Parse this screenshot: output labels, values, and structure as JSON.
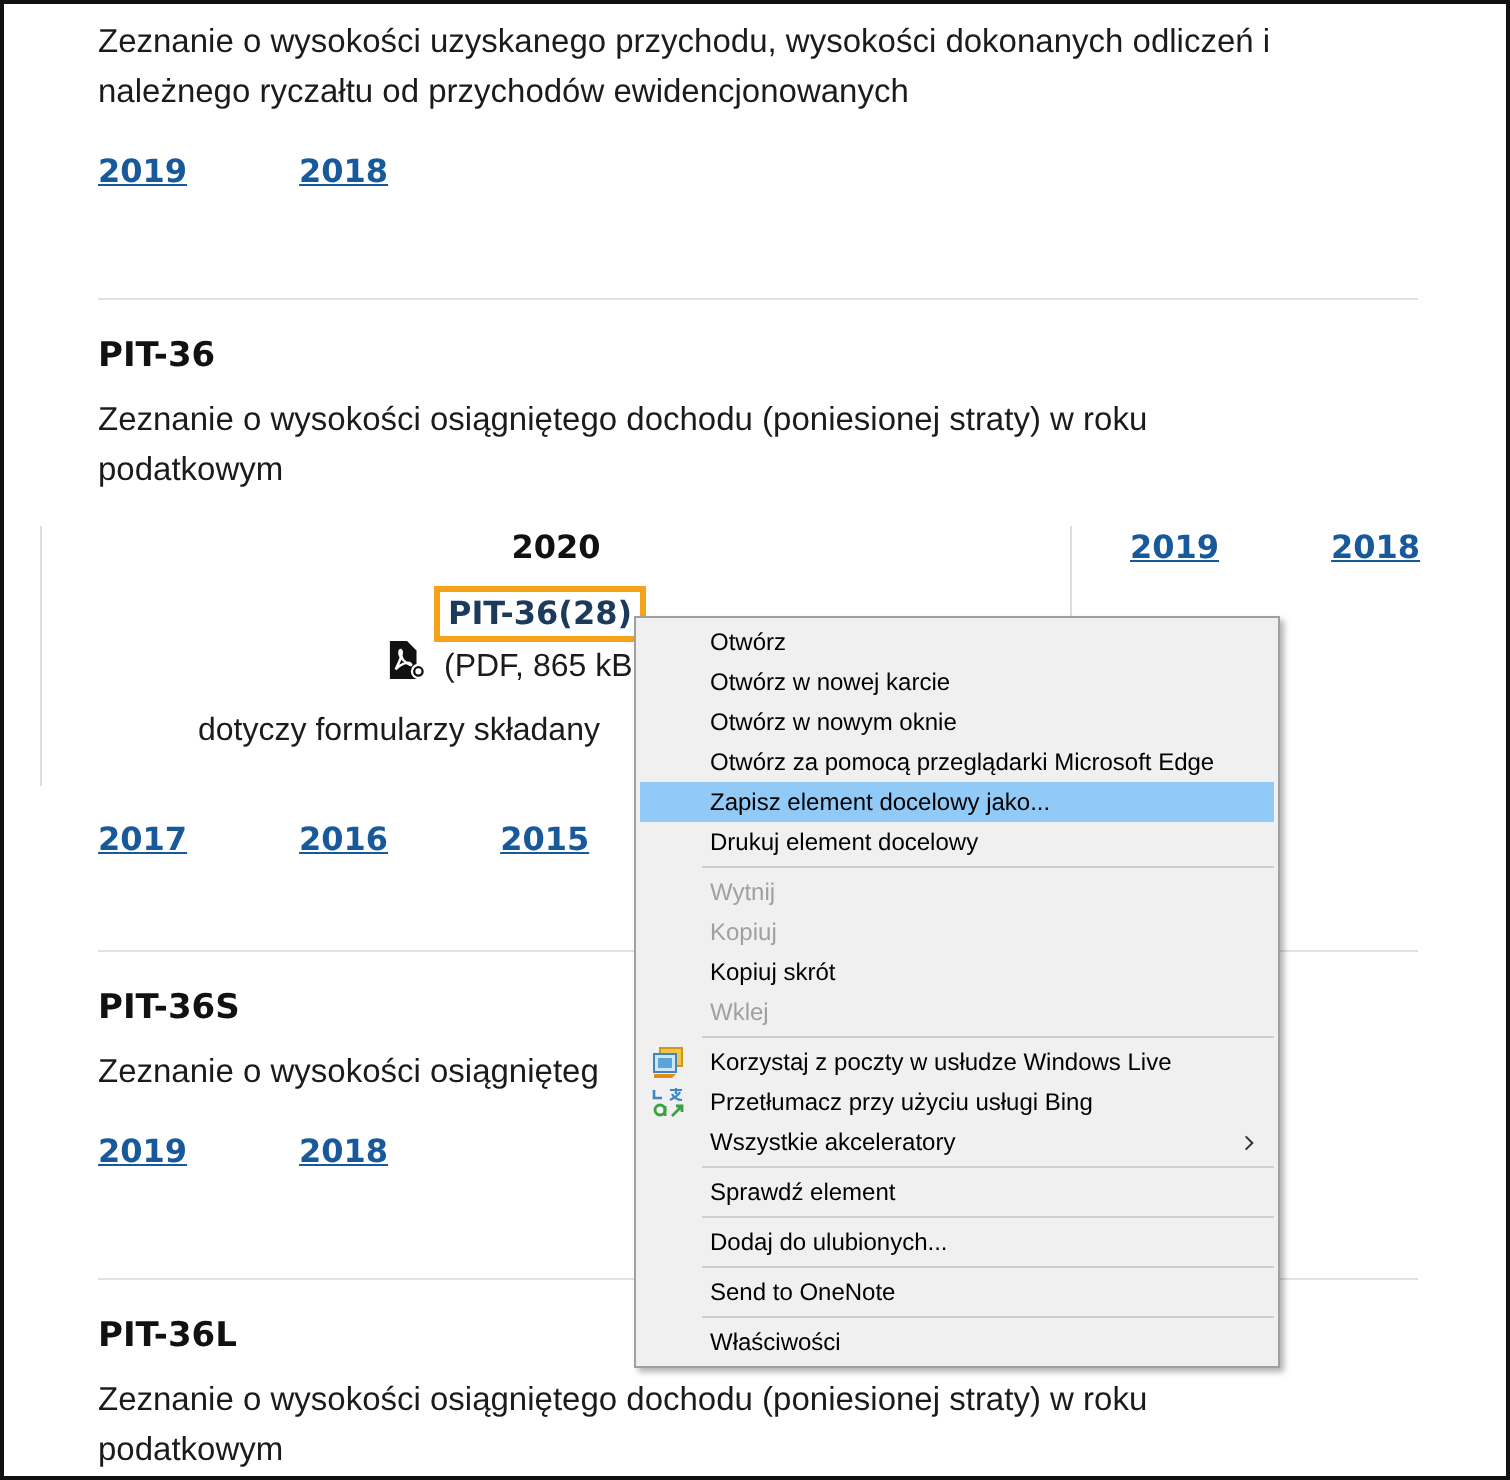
{
  "sections": [
    {
      "description": "Zeznanie o wysokości uzyskanego przychodu, wysokości dokonanych odliczeń i należnego ryczałtu od przychodów ewidencjonowanych",
      "years": [
        "2019",
        "2018"
      ]
    },
    {
      "heading": "PIT-36",
      "description": "Zeznanie o wysokości osiągniętego dochodu (poniesionej straty) w roku podatkowym",
      "featured": {
        "year": "2020",
        "file": {
          "title": "PIT-36(28)",
          "focused": true,
          "size": "(PDF, 865 kB",
          "note": "dotyczy formularzy składany"
        },
        "side_years": [
          "2019",
          "2018"
        ]
      },
      "years": [
        "2017",
        "2016",
        "2015"
      ]
    },
    {
      "heading": "PIT-36S",
      "description": "Zeznanie o wysokości osiągnięteg",
      "years": [
        "2019",
        "2018"
      ]
    },
    {
      "heading": "PIT-36L",
      "description": "Zeznanie o wysokości osiągniętego dochodu (poniesionej straty) w roku podatkowym"
    }
  ],
  "context_menu": {
    "items": [
      {
        "kind": "item",
        "label": "Otwórz",
        "disabled": false,
        "selected": false
      },
      {
        "kind": "item",
        "label": "Otwórz w nowej karcie",
        "disabled": false,
        "selected": false
      },
      {
        "kind": "item",
        "label": "Otwórz w nowym oknie",
        "disabled": false,
        "selected": false
      },
      {
        "kind": "item",
        "label": "Otwórz za pomocą przeglądarki Microsoft Edge",
        "disabled": false,
        "selected": false
      },
      {
        "kind": "item",
        "label": "Zapisz element docelowy jako...",
        "disabled": false,
        "selected": true
      },
      {
        "kind": "item",
        "label": "Drukuj element docelowy",
        "disabled": false,
        "selected": false
      },
      {
        "kind": "separator"
      },
      {
        "kind": "item",
        "label": "Wytnij",
        "disabled": true,
        "selected": false
      },
      {
        "kind": "item",
        "label": "Kopiuj",
        "disabled": true,
        "selected": false
      },
      {
        "kind": "item",
        "label": "Kopiuj skrót",
        "disabled": false,
        "selected": false
      },
      {
        "kind": "item",
        "label": "Wklej",
        "disabled": true,
        "selected": false
      },
      {
        "kind": "separator"
      },
      {
        "kind": "icon-item",
        "label": "Korzystaj z poczty w usłudze Windows Live",
        "disabled": false,
        "selected": false
      },
      {
        "kind": "icon-item",
        "label": "Przetłumacz przy użyciu usługi Bing",
        "disabled": false,
        "selected": false
      },
      {
        "kind": "item",
        "label": "Wszystkie akceleratory",
        "disabled": false,
        "selected": false,
        "submenu": true
      },
      {
        "kind": "separator"
      },
      {
        "kind": "item",
        "label": "Sprawdź element",
        "disabled": false,
        "selected": false
      },
      {
        "kind": "separator"
      },
      {
        "kind": "item",
        "label": "Dodaj do ulubionych...",
        "disabled": false,
        "selected": false
      },
      {
        "kind": "separator"
      },
      {
        "kind": "item",
        "label": "Send to OneNote",
        "disabled": false,
        "selected": false
      },
      {
        "kind": "separator"
      },
      {
        "kind": "item",
        "label": "Właściwości",
        "disabled": false,
        "selected": false
      }
    ]
  }
}
